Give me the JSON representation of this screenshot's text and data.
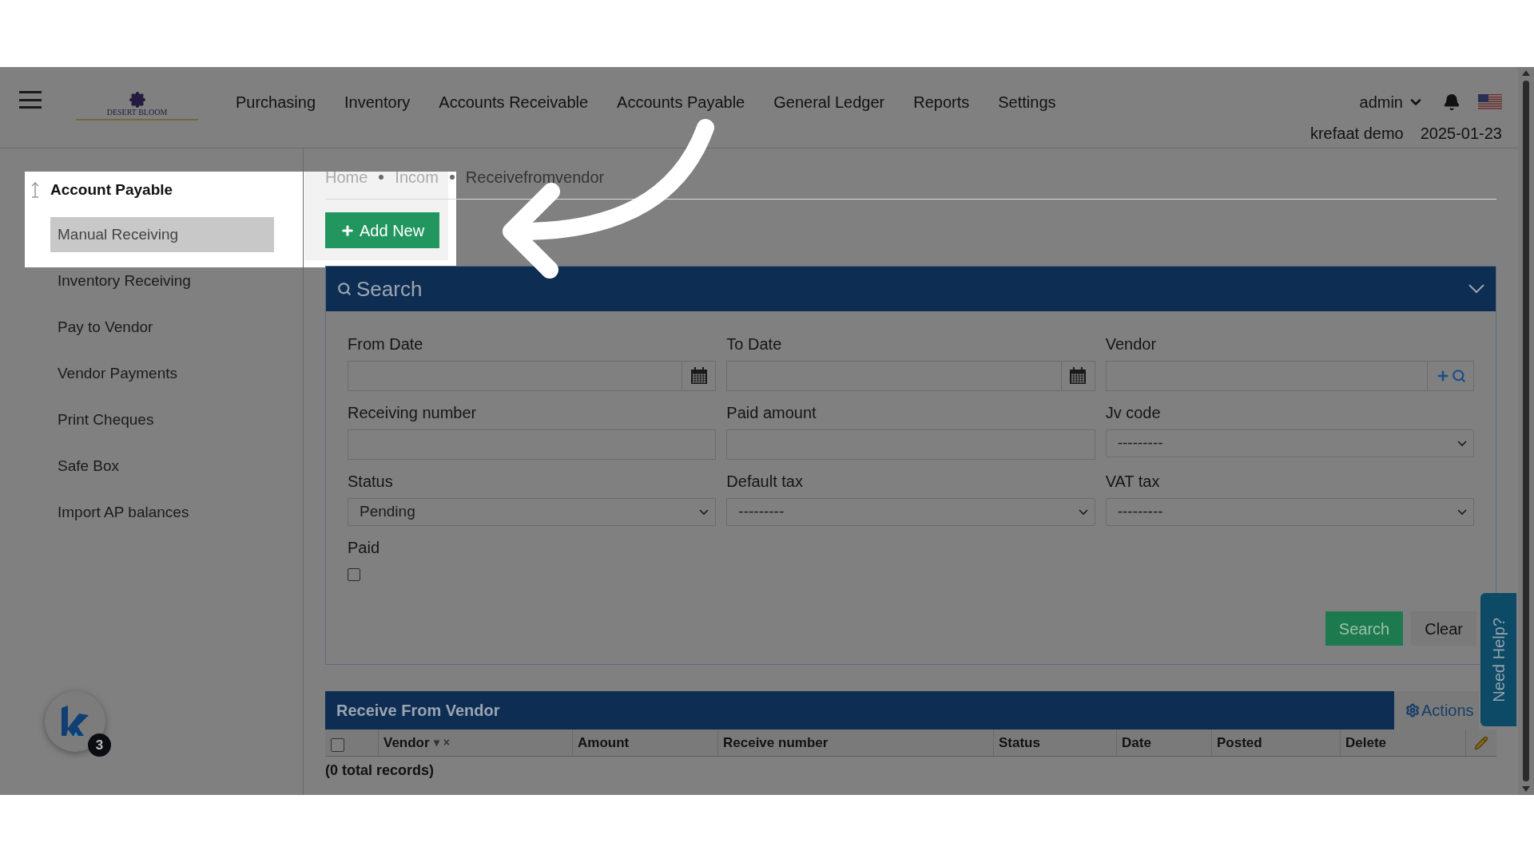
{
  "header": {
    "logo_text": "DESERT BLOOM",
    "nav": [
      "Purchasing",
      "Inventory",
      "Accounts Receivable",
      "Accounts Payable",
      "General Ledger",
      "Reports",
      "Settings"
    ],
    "user": "admin",
    "company": "krefaat demo",
    "date": "2025-01-23"
  },
  "sidebar": {
    "title": "Account Payable",
    "items": [
      {
        "label": "Manual Receiving",
        "selected": true
      },
      {
        "label": "Inventory Receiving",
        "selected": false
      },
      {
        "label": "Pay to Vendor",
        "selected": false
      },
      {
        "label": "Vendor Payments",
        "selected": false
      },
      {
        "label": "Print Cheques",
        "selected": false
      },
      {
        "label": "Safe Box",
        "selected": false
      },
      {
        "label": "Import AP balances",
        "selected": false
      }
    ]
  },
  "breadcrumbs": [
    "Home",
    "Incom",
    "Receivefromvendor"
  ],
  "add_button": "Add New",
  "search_panel": {
    "title": "Search",
    "fields": [
      {
        "kind": "date",
        "label": "From Date"
      },
      {
        "kind": "date",
        "label": "To Date"
      },
      {
        "kind": "vendor",
        "label": "Vendor"
      },
      {
        "kind": "text",
        "label": "Receiving number"
      },
      {
        "kind": "text",
        "label": "Paid amount"
      },
      {
        "kind": "select",
        "label": "Jv code",
        "value": "---------"
      },
      {
        "kind": "select",
        "label": "Status",
        "value": "Pending"
      },
      {
        "kind": "select",
        "label": "Default tax",
        "value": "---------"
      },
      {
        "kind": "select",
        "label": "VAT tax",
        "value": "---------"
      },
      {
        "kind": "checkbox",
        "label": "Paid",
        "checked": false
      }
    ],
    "buttons": [
      "Search",
      "Clear"
    ]
  },
  "table": {
    "title": "Receive From Vendor",
    "actions": "Actions",
    "select_all": {
      "checked": false
    },
    "columns": [
      {
        "label": "Vendor",
        "marks": [
          "▾",
          "×"
        ]
      },
      {
        "label": "Amount"
      },
      {
        "label": "Receive number"
      },
      {
        "label": "Status"
      },
      {
        "label": "Date"
      },
      {
        "label": "Posted"
      },
      {
        "label": "Delete"
      }
    ],
    "footer": "(0 total records)"
  },
  "help_tab": "Need Help?",
  "chat_badge": "3"
}
